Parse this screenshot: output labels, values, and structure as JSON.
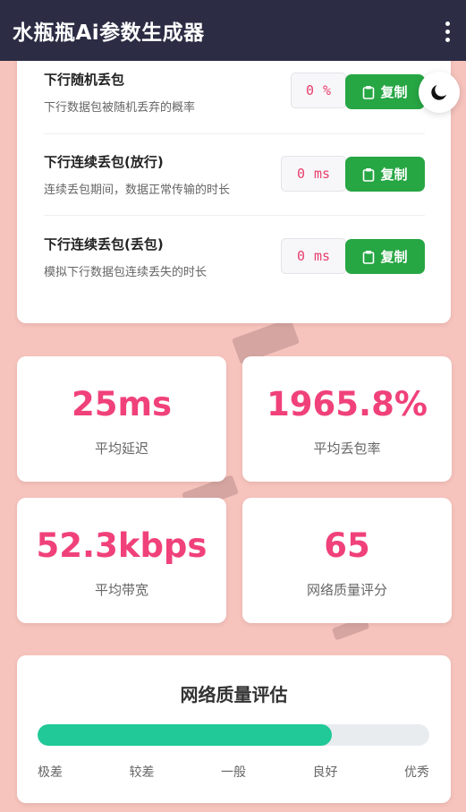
{
  "app": {
    "title": "水瓶瓶Ai参数生成器"
  },
  "params": [
    {
      "title": "下行随机丢包",
      "desc": "下行数据包被随机丢弃的概率",
      "value": "0",
      "unit": "%",
      "copy_label": "复制"
    },
    {
      "title": "下行连续丢包(放行)",
      "desc": "连续丢包期间，数据正常传输的时长",
      "value": "0",
      "unit": "ms",
      "copy_label": "复制"
    },
    {
      "title": "下行连续丢包(丢包)",
      "desc": "模拟下行数据包连续丢失的时长",
      "value": "0",
      "unit": "ms",
      "copy_label": "复制"
    }
  ],
  "stats": [
    {
      "value": "25ms",
      "label": "平均延迟"
    },
    {
      "value": "1965.8%",
      "label": "平均丢包率"
    },
    {
      "value": "52.3kbps",
      "label": "平均带宽"
    },
    {
      "value": "65",
      "label": "网络质量评分"
    }
  ],
  "quality": {
    "title": "网络质量评估",
    "progress_percent": 75,
    "levels": [
      "极差",
      "较差",
      "一般",
      "良好",
      "优秀"
    ]
  },
  "colors": {
    "accent": "#f0417a",
    "copy_button": "#27a644",
    "progress": "#20c997",
    "appbar": "#2c2d44",
    "background": "#f7c3bd"
  },
  "icons": {
    "menu": "more-vert-icon",
    "theme": "moon-icon",
    "copy": "clipboard-icon"
  }
}
